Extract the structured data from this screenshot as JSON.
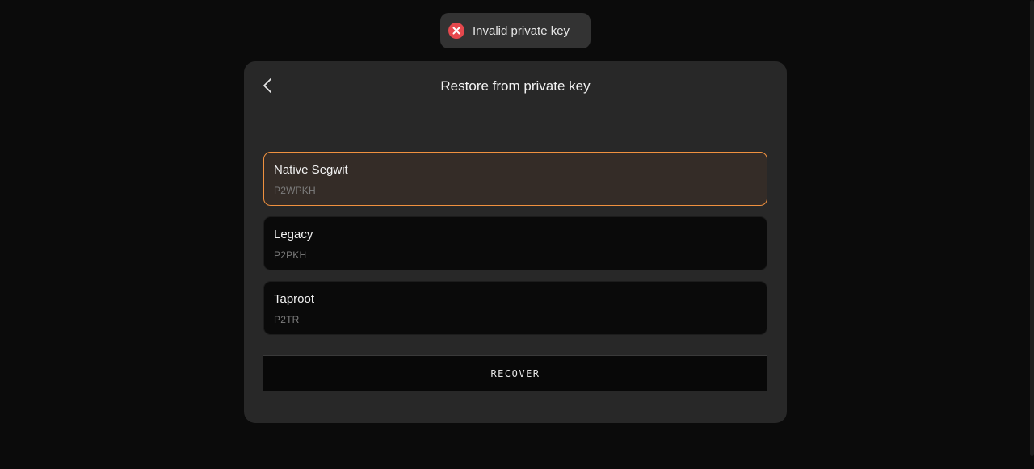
{
  "toast": {
    "icon": "error-x-icon",
    "message": "Invalid private key",
    "color": "#e5484d"
  },
  "header": {
    "back_icon": "chevron-left-icon",
    "title": "Restore from private key"
  },
  "options": [
    {
      "title": "Native Segwit",
      "subtitle": "P2WPKH",
      "selected": true
    },
    {
      "title": "Legacy",
      "subtitle": "P2PKH",
      "selected": false
    },
    {
      "title": "Taproot",
      "subtitle": "P2TR",
      "selected": false
    }
  ],
  "actions": {
    "recover_label": "RECOVER"
  },
  "colors": {
    "accent": "#f0913f",
    "background": "#0b0b0b",
    "card": "#282828"
  }
}
